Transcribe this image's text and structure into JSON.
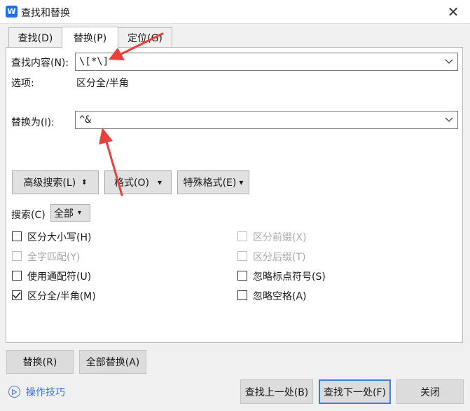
{
  "window": {
    "title": "查找和替换",
    "app_badge": "W",
    "close_glyph": "✕"
  },
  "tabs": [
    {
      "label": "查找(D)",
      "active": false
    },
    {
      "label": "替换(P)",
      "active": true
    },
    {
      "label": "定位(G)",
      "active": false
    }
  ],
  "find": {
    "label": "查找内容(N):",
    "value": "\\[*\\]"
  },
  "options": {
    "label": "选项:",
    "value": "区分全/半角"
  },
  "replace": {
    "label": "替换为(I):",
    "value": "^&"
  },
  "action_buttons": {
    "advanced": "高级搜索(L)",
    "advanced_glyph": "⬍",
    "format": "格式(O)",
    "special": "特殊格式(E)",
    "dropdown_glyph": "▾"
  },
  "search": {
    "label": "搜索(C)",
    "value": "全部"
  },
  "checkboxes": {
    "case": {
      "label": "区分大小写(H)",
      "checked": false,
      "disabled": false
    },
    "whole": {
      "label": "全字匹配(Y)",
      "checked": false,
      "disabled": true
    },
    "wildcard": {
      "label": "使用通配符(U)",
      "checked": false,
      "disabled": false
    },
    "width": {
      "label": "区分全/半角(M)",
      "checked": true,
      "disabled": false
    },
    "prefix": {
      "label": "区分前缀(X)",
      "checked": false,
      "disabled": true
    },
    "suffix": {
      "label": "区分后缀(T)",
      "checked": false,
      "disabled": true
    },
    "punct": {
      "label": "忽略标点符号(S)",
      "checked": false,
      "disabled": false
    },
    "space": {
      "label": "忽略空格(A)",
      "checked": false,
      "disabled": false
    }
  },
  "bottom": {
    "replace": "替换(R)",
    "replace_all": "全部替换(A)",
    "tips": "操作技巧",
    "find_prev": "查找上一处(B)",
    "find_next": "查找下一处(F)",
    "close": "关闭"
  },
  "colors": {
    "annotation_arrow": "#e8403a",
    "primary_border": "#3c7fd8",
    "link": "#3b6fd8"
  }
}
